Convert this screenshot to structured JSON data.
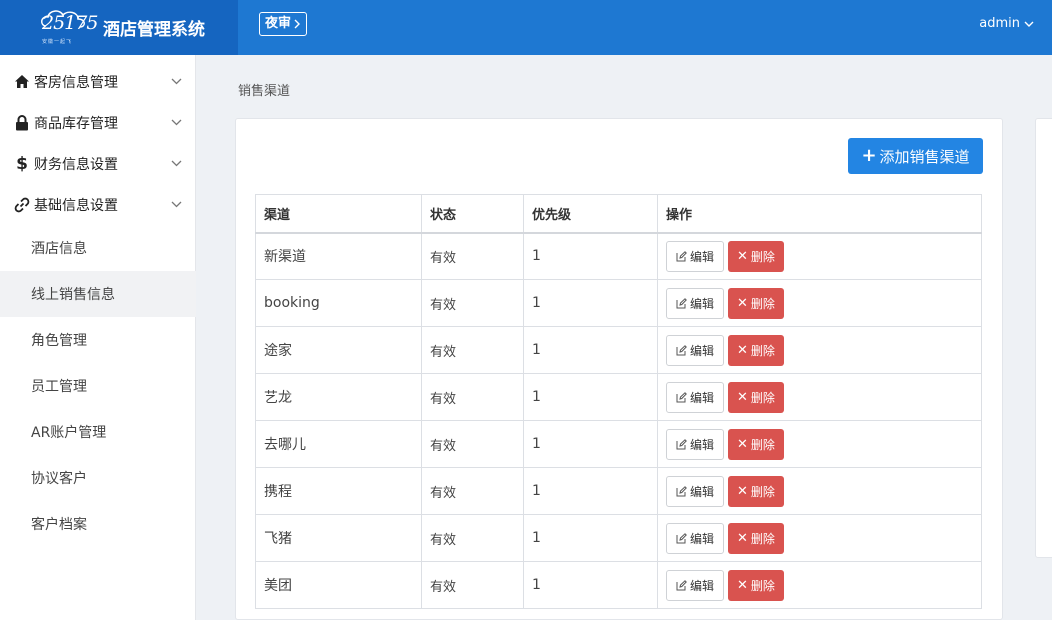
{
  "header": {
    "logo_text": "25175",
    "logo_tagline": "安徽一起飞",
    "app_title": "酒店管理系统",
    "night_audit_label": "夜审",
    "user_name": "admin"
  },
  "sidebar": {
    "menus": [
      {
        "label": "客房信息管理",
        "icon": "home-icon"
      },
      {
        "label": "商品库存管理",
        "icon": "lock-icon"
      },
      {
        "label": "财务信息设置",
        "icon": "dollar-icon"
      },
      {
        "label": "基础信息设置",
        "icon": "link-icon"
      }
    ],
    "sub_items": [
      {
        "label": "酒店信息",
        "active": false
      },
      {
        "label": "线上销售信息",
        "active": true
      },
      {
        "label": "角色管理",
        "active": false
      },
      {
        "label": "员工管理",
        "active": false
      },
      {
        "label": "AR账户管理",
        "active": false
      },
      {
        "label": "协议客户",
        "active": false
      },
      {
        "label": "客户档案",
        "active": false
      }
    ]
  },
  "breadcrumb": "销售渠道",
  "add_button_label": "添加销售渠道",
  "table": {
    "headers": [
      "渠道",
      "状态",
      "优先级",
      "操作"
    ],
    "edit_label": "编辑",
    "delete_label": "删除",
    "rows": [
      {
        "name": "新渠道",
        "status": "有效",
        "priority": "1"
      },
      {
        "name": "booking",
        "status": "有效",
        "priority": "1"
      },
      {
        "name": "途家",
        "status": "有效",
        "priority": "1"
      },
      {
        "name": "艺龙",
        "status": "有效",
        "priority": "1"
      },
      {
        "name": "去哪儿",
        "status": "有效",
        "priority": "1"
      },
      {
        "name": "携程",
        "status": "有效",
        "priority": "1"
      },
      {
        "name": "飞猪",
        "status": "有效",
        "priority": "1"
      },
      {
        "name": "美团",
        "status": "有效",
        "priority": "1"
      }
    ]
  },
  "colors": {
    "header_bg": "#1e78d2",
    "logo_bg": "#1565c0",
    "primary": "#2385e3",
    "danger": "#d9534f"
  }
}
